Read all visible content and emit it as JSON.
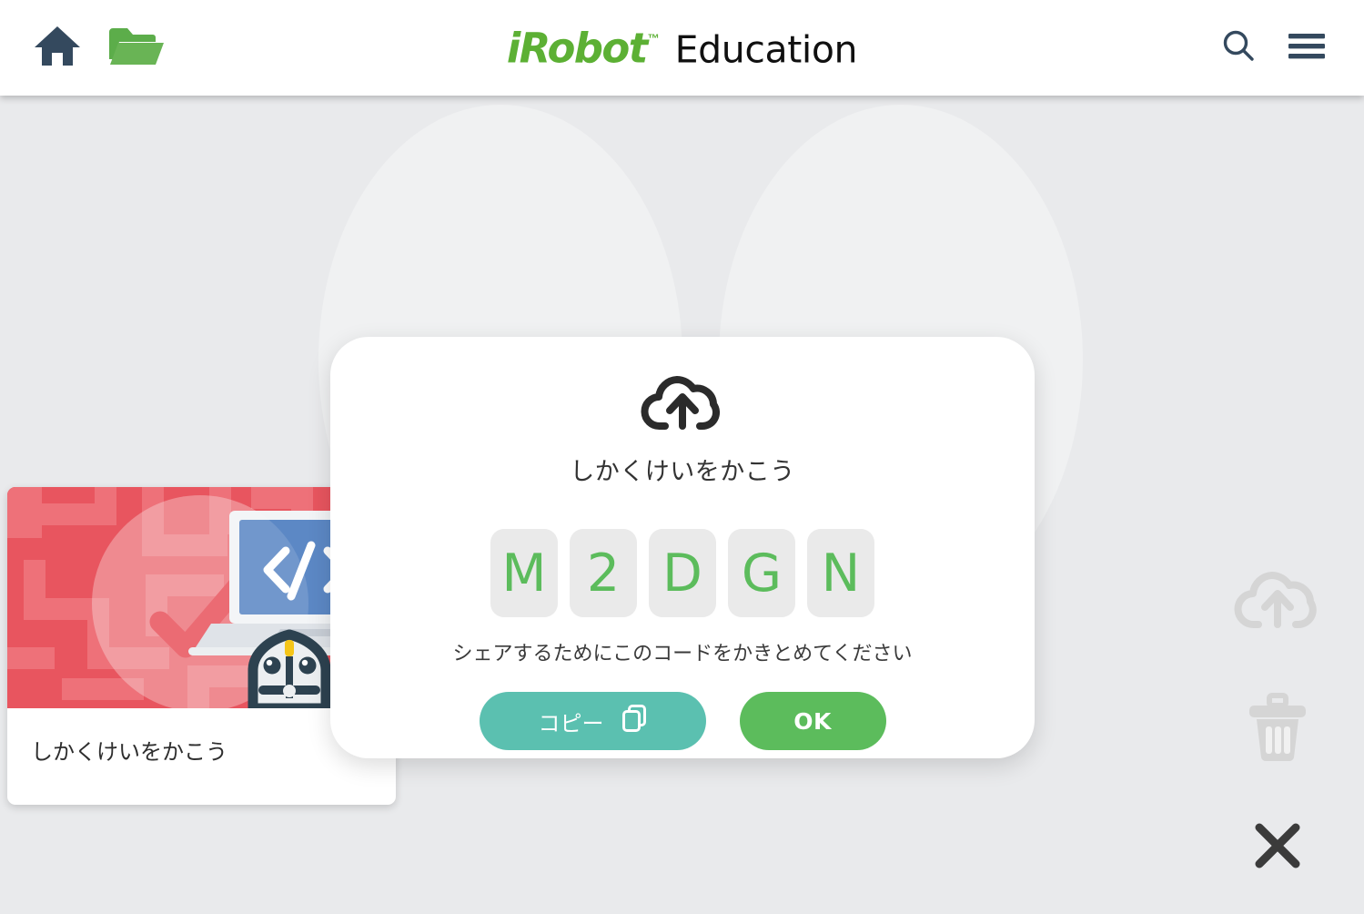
{
  "header": {
    "home_icon": "home-icon",
    "folder_icon": "folder-open-icon",
    "brand_primary": "iRobot",
    "brand_tm": "™",
    "brand_secondary": "Education",
    "search_icon": "search-icon",
    "menu_icon": "hamburger-menu-icon",
    "colors": {
      "brand_green": "#5cb034",
      "icon_dark": "#34495e",
      "folder_green": "#5cad4a",
      "bar_background": "#ffffff"
    }
  },
  "project_card": {
    "title": "しかくけいをかこう",
    "thumbnail": {
      "alt": "code-laptop-robot-illustration",
      "background_color": "#e8555f",
      "pattern_color": "#ee7179",
      "laptop_screen_color": "#4a7bbf",
      "code_glyph": "</>",
      "check_color": "#e8555f",
      "robot_outline_color": "#2d4250",
      "robot_body_color": "#eceff1",
      "robot_marker_color": "#f5c518"
    }
  },
  "modal": {
    "icon": "cloud-upload-icon",
    "title": "しかくけいをかこう",
    "code": [
      "M",
      "2",
      "D",
      "G",
      "N"
    ],
    "hint": "シェアするためにこのコードをかきとめてください",
    "copy_button": {
      "label": "コピー",
      "icon": "copy-icon",
      "color": "#5bc0b0"
    },
    "ok_button": {
      "label": "OK",
      "color": "#5cbc5c"
    },
    "code_cell_background": "#eaeaea",
    "code_text_color": "#5cbc5c"
  },
  "action_rail": {
    "items": [
      {
        "name": "cloud-upload-icon",
        "state": "disabled",
        "color": "#d5d5d5"
      },
      {
        "name": "trash-icon",
        "state": "disabled",
        "color": "#d5d5d5"
      },
      {
        "name": "close-icon",
        "state": "active",
        "color": "#3b3b3b"
      }
    ]
  },
  "page": {
    "background_color": "#e9eaec",
    "blob_color": "#f0f1f2"
  }
}
